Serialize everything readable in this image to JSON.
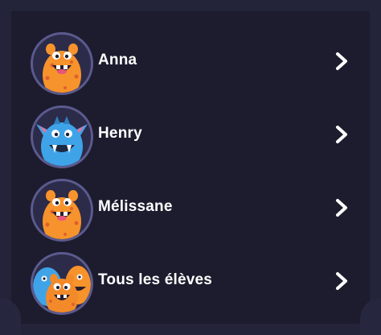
{
  "students": [
    {
      "name": "Anna",
      "avatar_icon": "orange-monster-icon"
    },
    {
      "name": "Henry",
      "avatar_icon": "blue-monster-icon"
    },
    {
      "name": "Mélissane",
      "avatar_icon": "orange-monster-icon"
    },
    {
      "name": "Tous les élèves",
      "avatar_icon": "monster-group-icon"
    }
  ],
  "colors": {
    "background": "#1c1c2e",
    "avatar_ring": "#5b5a8e",
    "text": "#ffffff",
    "orange_monster": "#f7932c",
    "blue_monster": "#3fa3e8"
  }
}
